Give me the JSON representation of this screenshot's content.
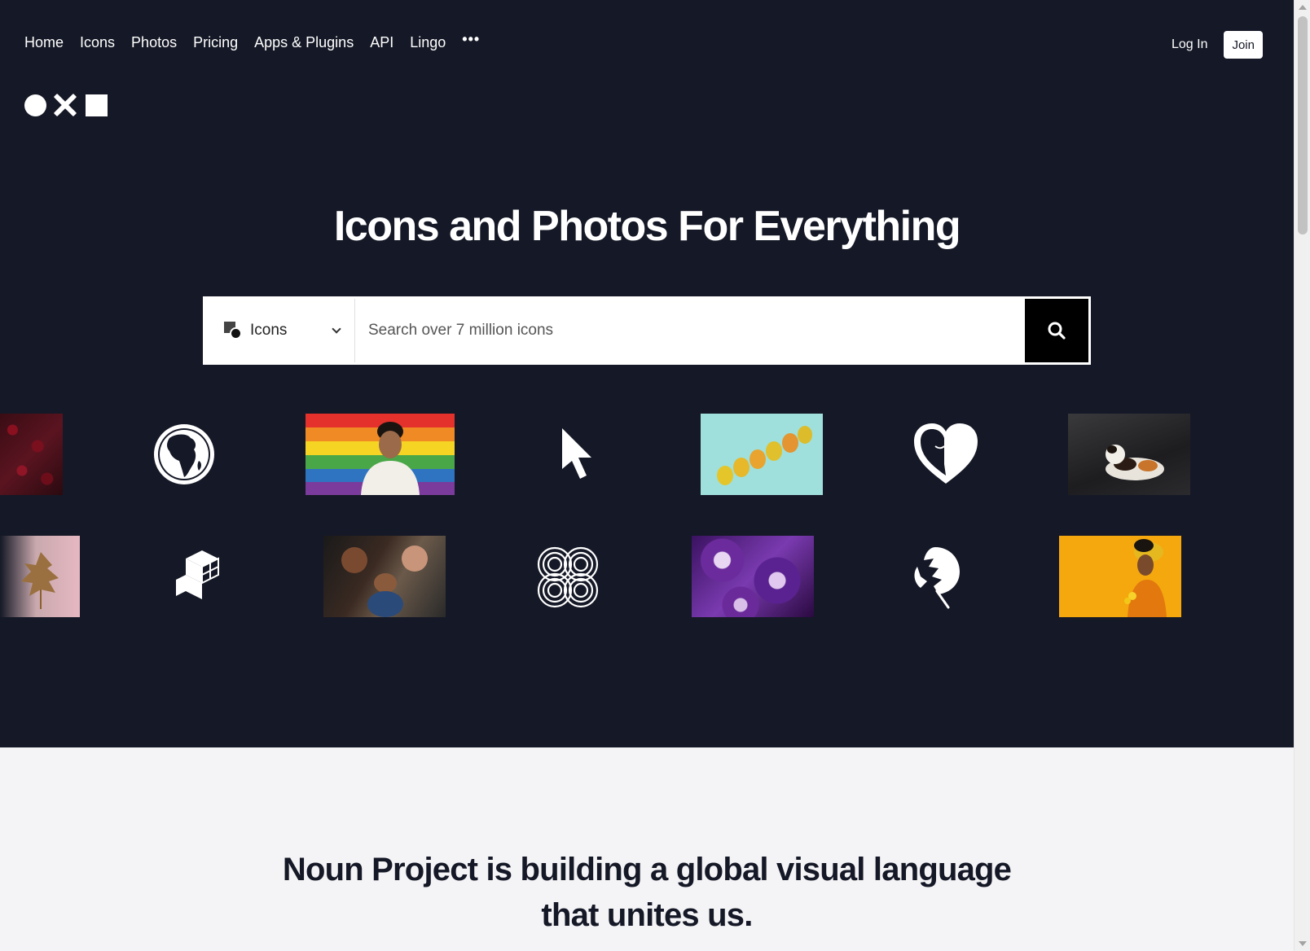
{
  "nav": {
    "items": [
      {
        "label": "Home"
      },
      {
        "label": "Icons"
      },
      {
        "label": "Photos"
      },
      {
        "label": "Pricing"
      },
      {
        "label": "Apps & Plugins"
      },
      {
        "label": "API"
      },
      {
        "label": "Lingo"
      }
    ],
    "more_label": "•••",
    "login_label": "Log In",
    "join_label": "Join"
  },
  "hero": {
    "headline": "Icons and Photos For Everything"
  },
  "search": {
    "type_label": "Icons",
    "placeholder": "Search over 7 million icons",
    "value": ""
  },
  "gallery": {
    "icons": [
      "globe-icon",
      "cursor-icon",
      "heart-face-icon",
      "cubes-icon",
      "interlocking-circles-icon",
      "monstera-leaf-icon"
    ],
    "photos": [
      "cherries",
      "pride-flag-person",
      "pears",
      "calico-cat",
      "dried-leaf",
      "family-with-baby",
      "petunias",
      "woman-yellow-background"
    ]
  },
  "mission": {
    "line1": "Noun Project is building a global visual language",
    "line2": "that unites us."
  },
  "colors": {
    "hero_background": "#151826",
    "page_background": "#f4f4f6",
    "search_button": "#000000"
  }
}
